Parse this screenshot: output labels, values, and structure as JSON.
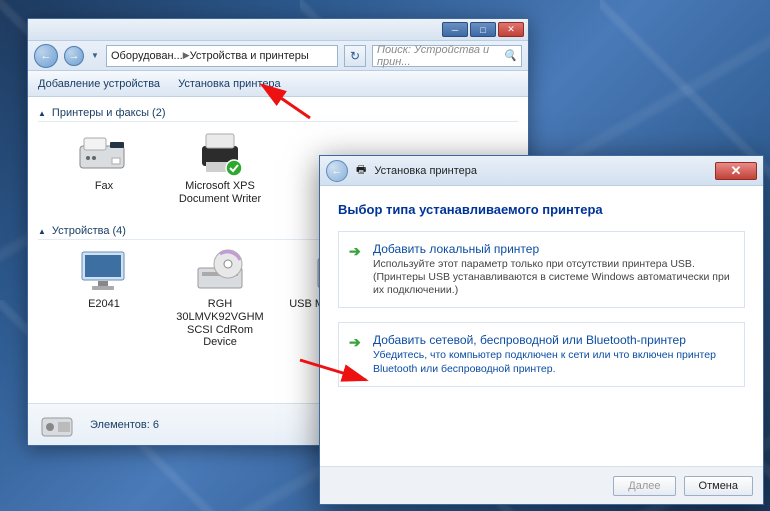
{
  "explorer": {
    "breadcrumb": {
      "parent": "Оборудован...",
      "current": "Устройства и принтеры"
    },
    "search_placeholder": "Поиск: Устройства и прин...",
    "commands": {
      "add_device": "Добавление устройства",
      "add_printer": "Установка принтера"
    },
    "group1": {
      "title": "Принтеры и факсы (2)",
      "items": [
        {
          "id": "fax",
          "label": "Fax"
        },
        {
          "id": "xps",
          "label": "Microsoft XPS Document Writer"
        }
      ]
    },
    "group2": {
      "title": "Устройства (4)",
      "items": [
        {
          "id": "monitor",
          "label": "E2041"
        },
        {
          "id": "cdrom",
          "label": "RGH 30LMVK92VGHM SCSI CdRom Device"
        },
        {
          "id": "usb",
          "label": "USB Mass Storage Device"
        }
      ]
    },
    "details": {
      "count_label": "Элементов: 6"
    }
  },
  "wizard": {
    "title": "Установка принтера",
    "heading": "Выбор типа устанавливаемого принтера",
    "option_local": {
      "title": "Добавить локальный принтер",
      "desc": "Используйте этот параметр только при отсутствии принтера USB. (Принтеры USB устанавливаются в системе Windows автоматически при их подключении.)"
    },
    "option_network": {
      "title": "Добавить сетевой, беспроводной или Bluetooth-принтер",
      "desc": "Убедитесь, что компьютер подключен к сети или что включен принтер Bluetooth или беспроводной принтер."
    },
    "buttons": {
      "next": "Далее",
      "cancel": "Отмена"
    }
  }
}
